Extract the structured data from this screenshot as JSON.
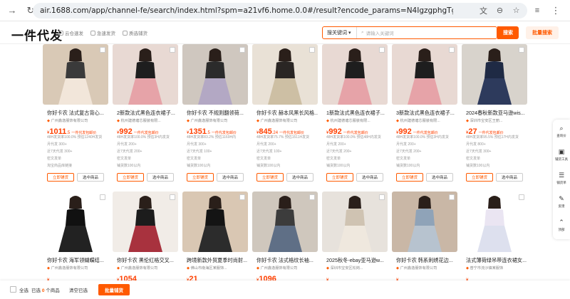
{
  "browser": {
    "url": "air.1688.com/app/channel-fe/search/index.html?spm=a21vf6.home.0.0#/result?encode_params=N4IgzgphgTgxgCwCoE8AOEQC4QGsIoDuA9j..."
  },
  "header": {
    "logo": "一件代发",
    "links": [
      "云仓速发",
      "急速发货",
      "质选铺货"
    ],
    "search_type": "搜关键词",
    "search_placeholder": "请输入关键词",
    "search_button": "搜索",
    "batch_search": "批量搜索"
  },
  "products": [
    {
      "title": "你好卡农 法式复古背心...",
      "store": "广州鑫逸服饰有限公司",
      "price": "1011",
      "price_sub": ".5",
      "price_tag": "一件代发包邮价",
      "meta1": "48H发货率100.0%  预估1240H发货",
      "meta2": "月代发 300+",
      "meta3": "近7天代发 300+",
      "meta4": "密文发单",
      "meta5": "淘宝商品库链接",
      "primary": "立即铺货",
      "secondary": "选中商品"
    },
    {
      "title": "2新款法式黑色连衣裙子...",
      "store": "杭州建德塘芯服装有限...",
      "price": "992",
      "price_sub": "",
      "price_tag": "一件代发包邮价",
      "meta1": "48H发货率100.0%  预估3H内发货",
      "meta2": "月代发 200+",
      "meta3": "近7天代发 200+",
      "meta4": "密文发单",
      "meta5": "铺货数100以内",
      "primary": "立即铺货",
      "secondary": "选中商品"
    },
    {
      "title": "你好卡农 不规则翻领荷...",
      "store": "广州鑫逸服饰有限公司",
      "price": "1351",
      "price_sub": ".5",
      "price_tag": "一件代发包邮价",
      "meta1": "48H发货率83.2%  预估1169H内",
      "meta2": "月代发 300+",
      "meta3": "近7天代发 100+",
      "meta4": "密文发单",
      "meta5": "铺货数100以内",
      "primary": "立即铺货",
      "secondary": "选中商品"
    },
    {
      "title": "你好卡农 赫本风黑长风格...",
      "store": "广州鑫逸服饰有限公司",
      "price": "845",
      "price_sub": ".24",
      "price_tag": "一件代发包邮价",
      "meta1": "48H发货率75.7%  预估1511H发货",
      "meta2": "月代发 200+",
      "meta3": "近7天代发 100+",
      "meta4": "密文发单",
      "meta5": "铺货数100以内",
      "primary": "立即铺货",
      "secondary": "选中商品"
    },
    {
      "title": "1新款法式黑色连衣裙子...",
      "store": "杭州建德塘芯服装有限...",
      "price": "992",
      "price_sub": "",
      "price_tag": "一件代发包邮价",
      "meta1": "48H发货率100.0%  预估48H内发货",
      "meta2": "月代发 200+",
      "meta3": "近7天代发 200+",
      "meta4": "密文发单",
      "meta5": "铺货数100以内",
      "primary": "立即铺货",
      "secondary": "选中商品"
    },
    {
      "title": "3新款法式黑色连衣裙子...",
      "store": "杭州建德塘芯服装有限...",
      "price": "992",
      "price_sub": "",
      "price_tag": "一件代发包邮价",
      "meta1": "48H发货率100.0%  预估3H内发货",
      "meta2": "月代发 200+",
      "meta3": "近7天代发 200+",
      "meta4": "密文发单",
      "meta5": "铺货数100以内",
      "primary": "立即铺货",
      "secondary": "选中商品"
    },
    {
      "title": "2024春秋新款亚马逊wis...",
      "store": "深圳市宝安区王丽...",
      "price": "27",
      "price_sub": "",
      "price_tag": "一件代发包邮价",
      "meta1": "48H发货率95.5%  预估17H内发货",
      "meta2": "月代发 800+",
      "meta3": "近7天代发 300+",
      "meta4": "密文发单",
      "meta5": "铺货数100以内",
      "primary": "立即铺货",
      "secondary": "选中商品"
    },
    {
      "title": "你好卡农 海军领蝴蝶结...",
      "store": "广州鑫逸服饰有限公司",
      "price": "",
      "price_sub": "",
      "price_tag": "",
      "meta1": "",
      "meta2": "",
      "meta3": "",
      "meta4": "",
      "meta5": "",
      "primary": "",
      "secondary": ""
    },
    {
      "title": "你好卡农 黑伦红格交叉...",
      "store": "广州鑫逸服饰有限公司",
      "price": "1054",
      "price_sub": "",
      "price_tag": "",
      "meta1": "",
      "meta2": "",
      "meta3": "",
      "meta4": "",
      "meta5": "",
      "primary": "",
      "secondary": ""
    },
    {
      "title": "跨境新款外贸夏季时尚射...",
      "store": "佛山市南海区某服饰...",
      "price": "21",
      "price_sub": "",
      "price_tag": "",
      "meta1": "",
      "meta2": "",
      "meta3": "",
      "meta4": "",
      "meta5": "",
      "primary": "",
      "secondary": ""
    },
    {
      "title": "你好卡农 法式格纹长袖...",
      "store": "广州鑫逸服饰有限公司",
      "price": "1096",
      "price_sub": "",
      "price_tag": "",
      "meta1": "",
      "meta2": "",
      "meta3": "",
      "meta4": "",
      "meta5": "",
      "primary": "",
      "secondary": ""
    },
    {
      "title": "2025秋冬-ebay亚马逊w...",
      "store": "深圳市宝安区松岗...",
      "price": "",
      "price_sub": "",
      "price_tag": "",
      "meta1": "",
      "meta2": "",
      "meta3": "",
      "meta4": "",
      "meta5": "",
      "primary": "",
      "secondary": ""
    },
    {
      "title": "你好卡农 韩系刺绣花边...",
      "store": "广州鑫逸服饰有限公司",
      "price": "",
      "price_sub": "",
      "price_tag": "",
      "meta1": "",
      "meta2": "",
      "meta3": "",
      "meta4": "",
      "meta5": "",
      "primary": "",
      "secondary": ""
    },
    {
      "title": "法式薄荷绿吊带连衣裙女...",
      "store": "普宁市流沙镇某服饰",
      "price": "",
      "price_sub": "",
      "price_tag": "",
      "meta1": "",
      "meta2": "",
      "meta3": "",
      "meta4": "",
      "meta5": "",
      "primary": "",
      "secondary": ""
    }
  ],
  "side_tools": [
    "查询价",
    "铺货工具",
    "铺货单",
    "反馈",
    "顶部"
  ],
  "bottom_bar": {
    "select_all": "全选",
    "selected_prefix": "已选",
    "selected_count": "0",
    "selected_suffix": "个商品",
    "clear": "清空已选",
    "batch_button": "批量铺货"
  },
  "colors": {
    "accent": "#ff5a00",
    "price": "#ff4000"
  }
}
